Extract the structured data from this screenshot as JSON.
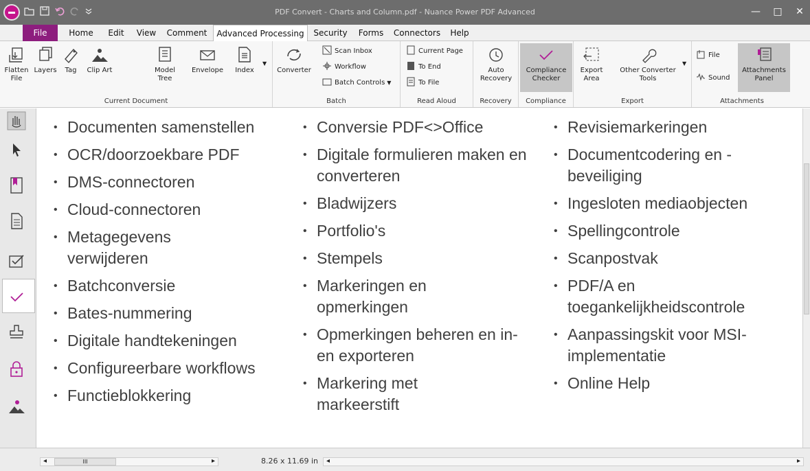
{
  "window": {
    "title": "PDF Convert - Charts and Column.pdf - Nuance Power PDF Advanced",
    "minimize_glyph": "—",
    "maximize_glyph": "□",
    "close_glyph": "✕"
  },
  "quick_access": [
    "open-icon",
    "save-icon",
    "undo-icon",
    "redo-icon",
    "customize-icon"
  ],
  "menu": {
    "tabs": [
      "File",
      "Home",
      "Edit",
      "View",
      "Comment",
      "Advanced Processing",
      "Security",
      "Forms",
      "Connectors",
      "Help"
    ],
    "active": "Advanced Processing"
  },
  "ribbon": {
    "groups": {
      "current_document": "Current Document",
      "batch": "Batch",
      "read_aloud": "Read Aloud",
      "recovery": "Recovery",
      "compliance": "Compliance",
      "export": "Export",
      "attachments": "Attachments"
    },
    "buttons": {
      "flatten_file": "Flatten File",
      "layers": "Layers",
      "tag": "Tag",
      "clip_art": "Clip Art",
      "model_tree": "Model Tree",
      "envelope": "Envelope",
      "index": "Index",
      "converter": "Converter",
      "scan_inbox": "Scan Inbox",
      "workflow": "Workflow",
      "batch_controls": "Batch Controls",
      "current_page": "Current Page",
      "to_end": "To End",
      "to_file": "To File",
      "auto_recovery": "Auto Recovery",
      "compliance_checker": "Compliance Checker",
      "export_area": "Export Area",
      "other_converter_tools": "Other Converter Tools",
      "file": "File",
      "sound": "Sound",
      "attachments_panel": "Attachments Panel"
    }
  },
  "document": {
    "column1": [
      "Documenten samenstellen",
      "OCR/doorzoekbare PDF",
      "DMS-connectoren",
      "Cloud-connectoren",
      "Metagegevens verwijderen",
      "Batchconversie",
      "Bates-nummering",
      "Digitale handtekeningen",
      "Configureerbare workflows",
      "Functieblokkering"
    ],
    "column2": [
      "Conversie PDF<>Office",
      "Digitale formulieren maken en converteren",
      "Bladwijzers",
      "Portfolio's",
      "Stempels",
      "Markeringen en opmerkingen",
      "Opmerkingen beheren en in- en exporteren",
      "Markering met markeerstift"
    ],
    "column3": [
      "Revisiemarkeringen",
      "Documentcodering en -beveiliging",
      "Ingesloten mediaobjecten",
      "Spellingcontrole",
      "Scanpostvak",
      "PDF/A en toegankelijkheidscontrole",
      "Aanpassingskit voor MSI-implementatie",
      "Online Help"
    ]
  },
  "status": {
    "page_size": "8.26 x 11.69 in",
    "scroll_left": "◂",
    "scroll_right": "▸",
    "grip": "III"
  },
  "colors": {
    "file_tab": "#8d1d7e",
    "titlebar": "#6d6d6d",
    "accent_check": "#b01e96"
  }
}
